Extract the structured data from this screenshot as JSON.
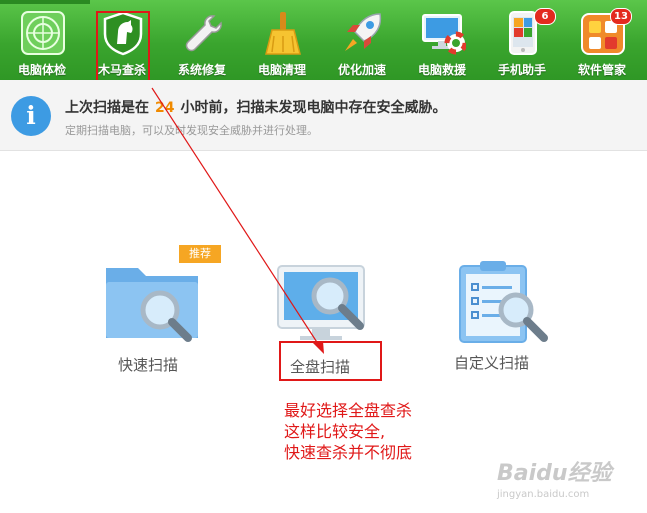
{
  "toolbar": {
    "items": [
      {
        "label": "电脑体检",
        "icon": "radar-scan-icon"
      },
      {
        "label": "木马查杀",
        "icon": "horse-shield-icon"
      },
      {
        "label": "系统修复",
        "icon": "wrench-icon"
      },
      {
        "label": "电脑清理",
        "icon": "broom-icon"
      },
      {
        "label": "优化加速",
        "icon": "rocket-icon"
      },
      {
        "label": "电脑救援",
        "icon": "lifebuoy-monitor-icon"
      },
      {
        "label": "手机助手",
        "icon": "phone-icon",
        "badge": "6"
      },
      {
        "label": "软件管家",
        "icon": "apps-grid-icon",
        "badge": "13"
      }
    ]
  },
  "info": {
    "main_prefix": "上次扫描是在",
    "hours": "24",
    "main_suffix": "小时前，扫描未发现电脑中存在安全威胁。",
    "sub": "定期扫描电脑，可以及时发现安全威胁并进行处理。"
  },
  "scan_options": {
    "quick": "快速扫描",
    "full": "全盘扫描",
    "custom": "自定义扫描",
    "recommend_badge": "推荐"
  },
  "annotation": {
    "lines": [
      "最好选择全盘查杀",
      "这样比较安全,",
      "快速查杀并不彻底"
    ],
    "color": "#e01818"
  },
  "watermark": {
    "brand": "Baidu经验",
    "site": "jingyan.baidu.com"
  },
  "colors": {
    "toolbar_green": "#3aa52e",
    "accent_orange": "#f08a00",
    "info_blue": "#3d9be3"
  }
}
